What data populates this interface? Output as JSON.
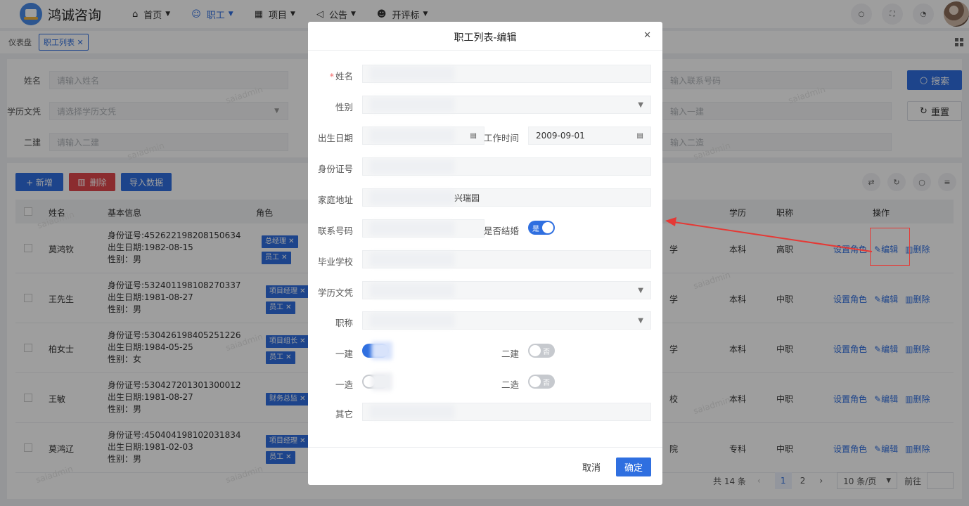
{
  "app": {
    "title": "鸿诚咨询"
  },
  "nav": [
    {
      "label": "首页",
      "icon": "home-icon",
      "active": false
    },
    {
      "label": "职工",
      "icon": "user-icon",
      "active": true
    },
    {
      "label": "项目",
      "icon": "grid-icon",
      "active": false
    },
    {
      "label": "公告",
      "icon": "speaker-icon",
      "active": false
    },
    {
      "label": "开评标",
      "icon": "users-icon",
      "active": false
    }
  ],
  "tabs": [
    {
      "label": "仪表盘",
      "active": false
    },
    {
      "label": "职工列表 ✕",
      "active": true
    }
  ],
  "search": {
    "name_label": "姓名",
    "name_placeholder": "请输入姓名",
    "edu_label": "学历文凭",
    "edu_placeholder": "请选择学历文凭",
    "jian2_label": "二建",
    "jian2_placeholder": "请输入二建",
    "phone_placeholder": "输入联系号码",
    "jian1_placeholder": "输入一建",
    "zao2_placeholder": "输入二造",
    "search_btn": "搜索",
    "reset_btn": "重置"
  },
  "toolbar": {
    "add": "+ 新增",
    "delete": "删除",
    "import": "导入数据"
  },
  "table": {
    "headers": {
      "name": "姓名",
      "info": "基本信息",
      "role": "角色",
      "edu": "学历",
      "title": "职称",
      "ops": "操作"
    },
    "rows": [
      {
        "name": "莫鸿钦",
        "id": "身份证号:452622198208150634",
        "birth": "出生日期:1982-08-15",
        "sex": "性别：男",
        "tags": [
          "总经理 ✕",
          "员工 ✕"
        ],
        "school_tail": "学",
        "edu": "本科",
        "title": "高职"
      },
      {
        "name": "王先生",
        "id": "身份证号:532401198108270337",
        "birth": "出生日期:1981-08-27",
        "sex": "性别：男",
        "tags": [
          "项目经理 ✕",
          "员工 ✕"
        ],
        "school_tail": "学",
        "edu": "本科",
        "title": "中职"
      },
      {
        "name": "柏女士",
        "id": "身份证号:530426198405251226",
        "birth": "出生日期:1984-05-25",
        "sex": "性别：女",
        "tags": [
          "项目组长 ✕",
          "员工 ✕"
        ],
        "school_tail": "学",
        "edu": "本科",
        "title": "中职"
      },
      {
        "name": "王敏",
        "id": "身份证号:530427201301300012",
        "birth": "出生日期:1981-08-27",
        "sex": "性别：男",
        "tags": [
          "财务总监 ✕"
        ],
        "school_tail": "校",
        "edu": "本科",
        "title": "中职"
      },
      {
        "name": "莫鸿辽",
        "id": "身份证号:450404198102031834",
        "birth": "出生日期:1981-02-03",
        "sex": "性别：男",
        "tags": [
          "项目经理 ✕",
          "员工 ✕"
        ],
        "school_tail": "院",
        "edu": "专科",
        "title": "中职"
      }
    ],
    "op_set_role": "设置角色",
    "op_edit": "编辑",
    "op_delete": "删除"
  },
  "pager": {
    "total": "共 14 条",
    "page1": "1",
    "page2": "2",
    "size": "10 条/页",
    "goto": "前往"
  },
  "watermark": "saiadmin",
  "dialog": {
    "title": "职工列表-编辑",
    "name_label": "姓名",
    "sex_label": "性别",
    "birth_label": "出生日期",
    "work_label": "工作时间",
    "work_value": "2009-09-01",
    "id_label": "身份证号",
    "addr_label": "家庭地址",
    "addr_tail": "兴瑞园",
    "phone_label": "联系号码",
    "married_label": "是否结婚",
    "married_on": "是",
    "school_label": "毕业学校",
    "edu_label": "学历文凭",
    "title_label": "职称",
    "jian1_label": "一建",
    "jian2_label": "二建",
    "jian2_off": "否",
    "zao1_label": "一造",
    "zao2_label": "二造",
    "zao2_off": "否",
    "other_label": "其它",
    "cancel": "取消",
    "ok": "确定"
  },
  "colors": {
    "primary": "#2f6fe0",
    "danger": "#e0474c",
    "annotation": "#e53935"
  }
}
